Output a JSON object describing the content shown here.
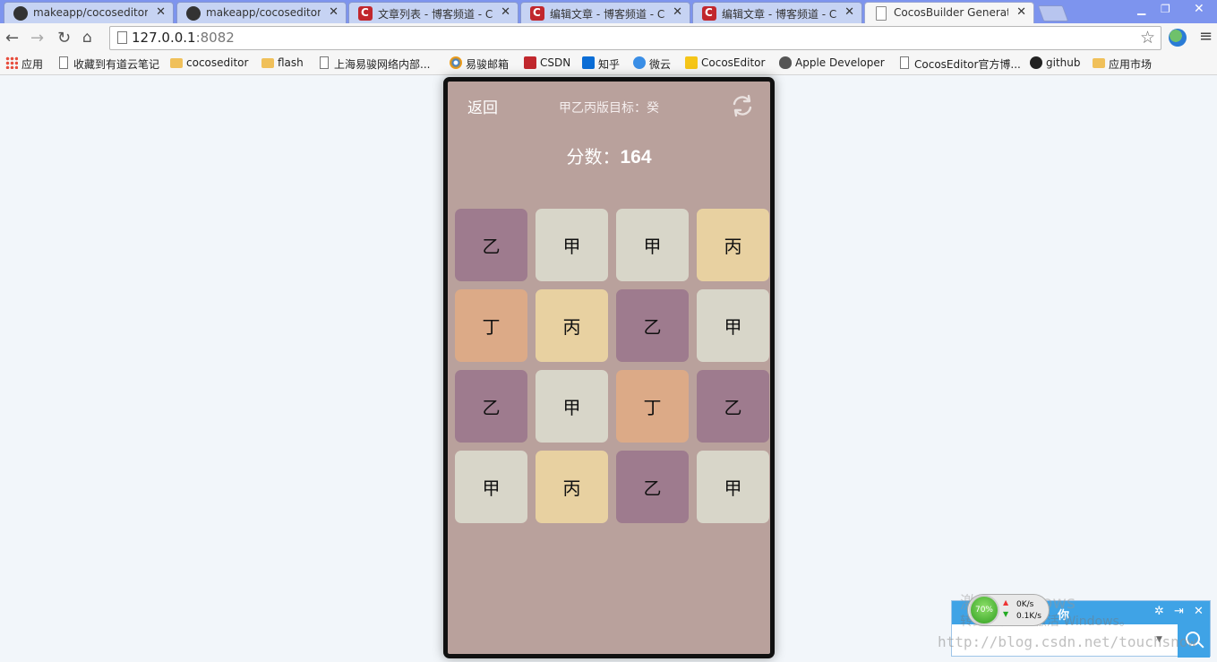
{
  "tabs": [
    {
      "title": "makeapp/cocoseditor-",
      "favicon": "github-icon"
    },
    {
      "title": "makeapp/cocoseditor-p",
      "favicon": "github-icon"
    },
    {
      "title": "文章列表 - 博客频道 - CS",
      "favicon": "csdn-icon"
    },
    {
      "title": "编辑文章 - 博客频道 - CS",
      "favicon": "csdn-icon"
    },
    {
      "title": "编辑文章 - 博客频道 - CS",
      "favicon": "csdn-icon"
    },
    {
      "title": "CocosBuilder Generated",
      "favicon": "page-icon",
      "active": true
    }
  ],
  "address": {
    "host": "127.0.0.1",
    "port": ":8082"
  },
  "bookmarks": [
    {
      "label": "应用",
      "icon": "apps-icon"
    },
    {
      "label": "收藏到有道云笔记",
      "icon": "page-icon"
    },
    {
      "label": "cocoseditor",
      "icon": "folder-icon"
    },
    {
      "label": "flash",
      "icon": "folder-icon"
    },
    {
      "label": "上海易骏网络内部...",
      "icon": "page-icon"
    },
    {
      "label": "易骏邮箱",
      "icon": "mail-icon"
    },
    {
      "label": "CSDN",
      "icon": "csdn-icon"
    },
    {
      "label": "知乎",
      "icon": "zhihu-icon"
    },
    {
      "label": "微云",
      "icon": "cloud-icon"
    },
    {
      "label": "CocosEditor",
      "icon": "cocos-icon"
    },
    {
      "label": "Apple Developer",
      "icon": "apple-icon"
    },
    {
      "label": "CocosEditor官方博...",
      "icon": "page-icon"
    },
    {
      "label": "github",
      "icon": "github-icon"
    },
    {
      "label": "应用市场",
      "icon": "folder-icon"
    }
  ],
  "game": {
    "back_label": "返回",
    "target_label": "甲乙丙版目标：癸",
    "score_label": "分数：",
    "score_value": "164",
    "colors": {
      "background": "#b9a19c",
      "乙": "#9e7b8e",
      "甲": "#d8d6c9",
      "丙": "#e8d1a1",
      "丁": "#dcaa87"
    },
    "grid": [
      [
        "乙",
        "甲",
        "甲",
        "丙"
      ],
      [
        "丁",
        "丙",
        "乙",
        "甲"
      ],
      [
        "乙",
        "甲",
        "丁",
        "乙"
      ],
      [
        "甲",
        "丙",
        "乙",
        "甲"
      ]
    ]
  },
  "widget": {
    "title": "你",
    "watermark_line1": "激活 Windows",
    "watermark_line2": "转到\"设置\"以激活 Windows。",
    "url_watermark": "http://blog.csdn.net/touchsnow",
    "net": {
      "percent": "70%",
      "up": "0K/s",
      "down": "0.1K/s"
    }
  }
}
